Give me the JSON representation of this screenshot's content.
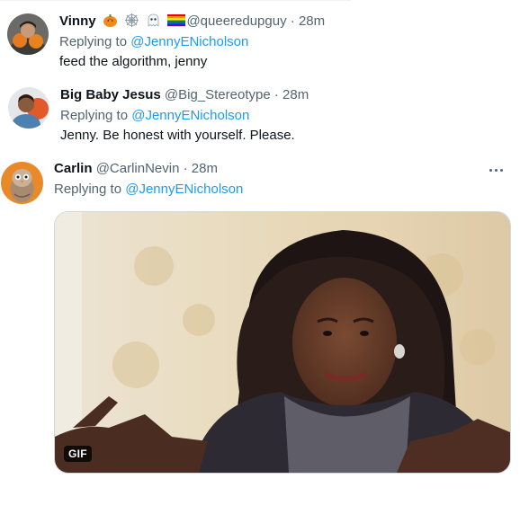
{
  "replies": [
    {
      "name": "Vinny",
      "emojis": [
        "pumpkin-icon",
        "spiderweb-icon",
        "ghost-icon",
        "rainbow-flag-icon"
      ],
      "handle": "@queeredupguy",
      "separator": "·",
      "time": "28m",
      "replying_prefix": "Replying to ",
      "mention": "@JennyENicholson",
      "text": "feed the algorithm, jenny"
    },
    {
      "name": "Big Baby Jesus",
      "handle": "@Big_Stereotype",
      "separator": "·",
      "time": "28m",
      "replying_prefix": "Replying to ",
      "mention": "@JennyENicholson",
      "text": "Jenny. Be honest with yourself. Please."
    },
    {
      "name": "Carlin",
      "handle": "@CarlinNevin",
      "separator": "·",
      "time": "28m",
      "replying_prefix": "Replying to ",
      "mention": "@JennyENicholson",
      "more_icon": "more-dots-icon",
      "media": {
        "type": "gif",
        "badge": "GIF"
      }
    }
  ],
  "colors": {
    "accent": "#1d9bf0",
    "secondary_text": "#536471",
    "primary_text": "#0f1419"
  }
}
